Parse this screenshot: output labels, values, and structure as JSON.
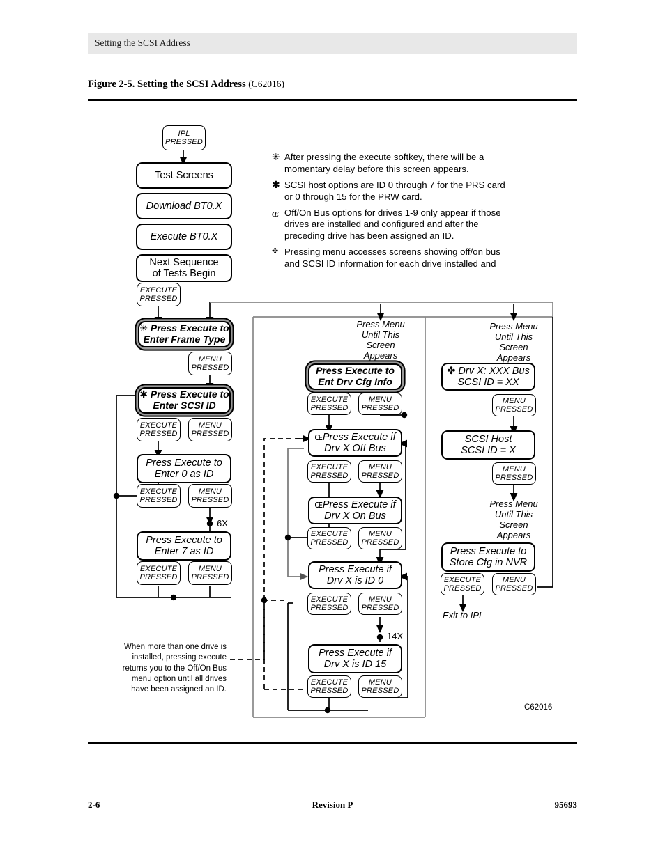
{
  "page": {
    "running_head": "Setting the SCSI Address",
    "figure_number": "Figure 2-5. Setting the SCSI Address",
    "figure_code": "(C62016)",
    "diagram_code": "C62016",
    "footer_left": "2-6",
    "footer_center": "Revision P",
    "footer_right": "95693"
  },
  "legend": {
    "items": [
      {
        "symbol": "✳",
        "text": "After pressing the execute softkey, there will be a momentary delay before this screen appears."
      },
      {
        "symbol": "✱",
        "text": "SCSI host options are ID 0 through 7 for the PRS card or 0 through 15 for the PRW card."
      },
      {
        "symbol": "ɶ",
        "text": "Off/On Bus options for drives 1-9 only appear if those drives are installed and configured and after the preceding drive has been assigned an ID."
      },
      {
        "symbol": "✤",
        "text": "Pressing menu accesses screens showing off/on bus and SCSI ID information for each drive installed and"
      }
    ]
  },
  "note": {
    "text": "When more than one drive is installed, pressing execute returns you to the Off/On Bus menu option until all drives have been assigned an ID."
  },
  "flow": {
    "left_column": {
      "ipl": {
        "line1": "IPL",
        "line2": "PRESSED"
      },
      "test_screens": "Test Screens",
      "download": "Download BT0.X",
      "execute_bt": "Execute BT0.X",
      "next_sequence": {
        "line1": "Next Sequence",
        "line2": "of Tests Begin"
      },
      "execute_pressed_1": {
        "line1": "EXECUTE",
        "line2": "PRESSED"
      },
      "frame_type": {
        "mark": "✳",
        "line1": "Press Execute to",
        "line2": "Enter Frame Type"
      },
      "menu_pressed_1": {
        "line1": "MENU",
        "line2": "PRESSED"
      },
      "scsi_id": {
        "mark": "✱",
        "line1": "Press Execute to",
        "line2": "Enter SCSI ID"
      },
      "execute_pressed_2": {
        "line1": "EXECUTE",
        "line2": "PRESSED"
      },
      "menu_pressed_2": {
        "line1": "MENU",
        "line2": "PRESSED"
      },
      "enter_0": {
        "line1": "Press Execute to",
        "line2": "Enter 0 as ID"
      },
      "execute_pressed_3": {
        "line1": "EXECUTE",
        "line2": "PRESSED"
      },
      "menu_pressed_3": {
        "line1": "MENU",
        "line2": "PRESSED"
      },
      "repeat_6x": "6X",
      "enter_7": {
        "line1": "Press Execute to",
        "line2": "Enter 7 as ID"
      },
      "execute_pressed_4": {
        "line1": "EXECUTE",
        "line2": "PRESSED"
      },
      "menu_pressed_4": {
        "line1": "MENU",
        "line2": "PRESSED"
      }
    },
    "middle_column": {
      "press_menu_label": "Press Menu\nUntil This\nScreen\nAppears",
      "drv_cfg_info": {
        "line1": "Press Execute to",
        "line2": "Ent Drv Cfg Info"
      },
      "execute_pressed_1": {
        "line1": "EXECUTE",
        "line2": "PRESSED"
      },
      "menu_pressed_1": {
        "line1": "MENU",
        "line2": "PRESSED"
      },
      "off_bus": {
        "mark": "ɶ",
        "line1": "Press Execute if",
        "line2": "Drv X Off Bus"
      },
      "execute_pressed_2": {
        "line1": "EXECUTE",
        "line2": "PRESSED"
      },
      "menu_pressed_2": {
        "line1": "MENU",
        "line2": "PRESSED"
      },
      "on_bus": {
        "mark": "ɶ",
        "line1": "Press Execute if",
        "line2": "Drv X On Bus"
      },
      "execute_pressed_3": {
        "line1": "EXECUTE",
        "line2": "PRESSED"
      },
      "menu_pressed_3": {
        "line1": "MENU",
        "line2": "PRESSED"
      },
      "id_0": {
        "line1": "Press Execute if",
        "line2": "Drv X is ID 0"
      },
      "execute_pressed_4": {
        "line1": "EXECUTE",
        "line2": "PRESSED"
      },
      "menu_pressed_4": {
        "line1": "MENU",
        "line2": "PRESSED"
      },
      "repeat_14x": "14X",
      "id_15": {
        "line1": "Press Execute if",
        "line2": "Drv X is ID 15"
      },
      "execute_pressed_5": {
        "line1": "EXECUTE",
        "line2": "PRESSED"
      },
      "menu_pressed_5": {
        "line1": "MENU",
        "line2": "PRESSED"
      }
    },
    "right_column": {
      "press_menu_label_1": "Press Menu\nUntil This\nScreen\nAppears",
      "drv_bus": {
        "mark": "✤",
        "line1": "Drv X: XXX Bus",
        "line2": "SCSI ID = XX"
      },
      "menu_pressed_1": {
        "line1": "MENU",
        "line2": "PRESSED"
      },
      "scsi_host": {
        "line1": "SCSI Host",
        "line2": "SCSI ID = X"
      },
      "menu_pressed_2": {
        "line1": "MENU",
        "line2": "PRESSED"
      },
      "press_menu_label_2": "Press Menu\nUntil This\nScreen\nAppears",
      "store_cfg": {
        "line1": "Press Execute to",
        "line2": "Store Cfg in NVR"
      },
      "execute_pressed_1": {
        "line1": "EXECUTE",
        "line2": "PRESSED"
      },
      "menu_pressed_3": {
        "line1": "MENU",
        "line2": "PRESSED"
      },
      "exit": "Exit to IPL"
    }
  },
  "colors": {
    "rule": "#000000",
    "header_band": "#e8e8e8",
    "wire": "#000000",
    "highlight_ring": "#9a9a9a"
  }
}
